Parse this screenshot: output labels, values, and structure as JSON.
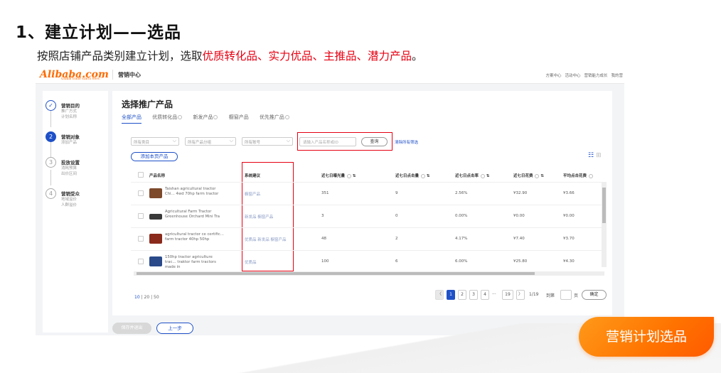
{
  "heading": "1、建立计划——选品",
  "description": {
    "prefix": "按照店铺产品类别建立计划，选取",
    "highlight": "优质转化品、实力优品、主推品、潜力产品",
    "suffix": "。"
  },
  "topbar": {
    "logo": "Alibaba.com",
    "logo_slogan": "Global trade starts here.™",
    "center_title": "营销中心",
    "links": [
      "方案中心",
      "活动中心",
      "营销能力成长",
      "我的营"
    ]
  },
  "steps": [
    {
      "num": "✓",
      "title": "营销目的",
      "subs": [
        "推广方式",
        "计划名称"
      ]
    },
    {
      "num": "2",
      "title": "营销对象",
      "subs": [
        "添加产品"
      ]
    },
    {
      "num": "3",
      "title": "投放设置",
      "subs": [
        "消耗预算",
        "出价区间"
      ]
    },
    {
      "num": "4",
      "title": "营销受众",
      "subs": [
        "地域溢价",
        "人群溢价"
      ]
    }
  ],
  "main": {
    "title": "选择推广产品",
    "tabs": [
      "全部产品",
      "优质转化品",
      "新发产品",
      "橱窗产品",
      "优先推广品"
    ],
    "filters": [
      "所有类目",
      "所有产品分组",
      "所有账号"
    ],
    "search_placeholder": "请输入产品名称或ID",
    "search_button": "查询",
    "clear_filters": "清除所有筛选",
    "add_page_button": "添加本页产品",
    "columns": [
      "产品名称",
      "系统建议",
      "近七日曝光量",
      "近七日点击量",
      "近七日点击率",
      "近七日花费",
      "平均点击花费"
    ],
    "rows": [
      {
        "name": "Taishan agricultural tractor Chi… 4wd 70hp farm tractor",
        "tags": [
          "橱窗产品"
        ],
        "exposure": "351",
        "clicks": "9",
        "ctr": "2.56%",
        "cost": "¥32.90",
        "avg": "¥3.66"
      },
      {
        "name": "Agricultural Farm Tractor Greenhouse Orchard Mini Tra",
        "tags": [
          "新发品",
          "橱窗产品"
        ],
        "exposure": "3",
        "clicks": "0",
        "ctr": "0.00%",
        "cost": "¥0.00",
        "avg": "¥0.00"
      },
      {
        "name": "agricultural tractor ce certific… farm tractor 40hp 50hp",
        "tags": [
          "优质品",
          "新发品",
          "橱窗产品"
        ],
        "exposure": "48",
        "clicks": "2",
        "ctr": "4.17%",
        "cost": "¥7.40",
        "avg": "¥3.70"
      },
      {
        "name": "150hp tractor agriculture trac… traktor farm tractors made in",
        "tags": [
          "优质品"
        ],
        "exposure": "100",
        "clicks": "6",
        "ctr": "6.00%",
        "cost": "¥25.80",
        "avg": "¥4.30"
      }
    ],
    "page_sizes": [
      "10",
      "20",
      "50"
    ],
    "pagination": {
      "pages": [
        "1",
        "2",
        "3",
        "4"
      ],
      "ellipsis": "···",
      "last": "19",
      "next": "〉",
      "prev": "〈",
      "status": "1/19",
      "goto_label": "到第",
      "page_label": "页",
      "confirm": "确定"
    },
    "save_exit": "保存并退出",
    "prev_step": "上一步"
  },
  "badge": "营销计划选品",
  "colors": {
    "accent": "#1e50c8",
    "highlight": "#e60012",
    "badge": "#ff7200"
  }
}
